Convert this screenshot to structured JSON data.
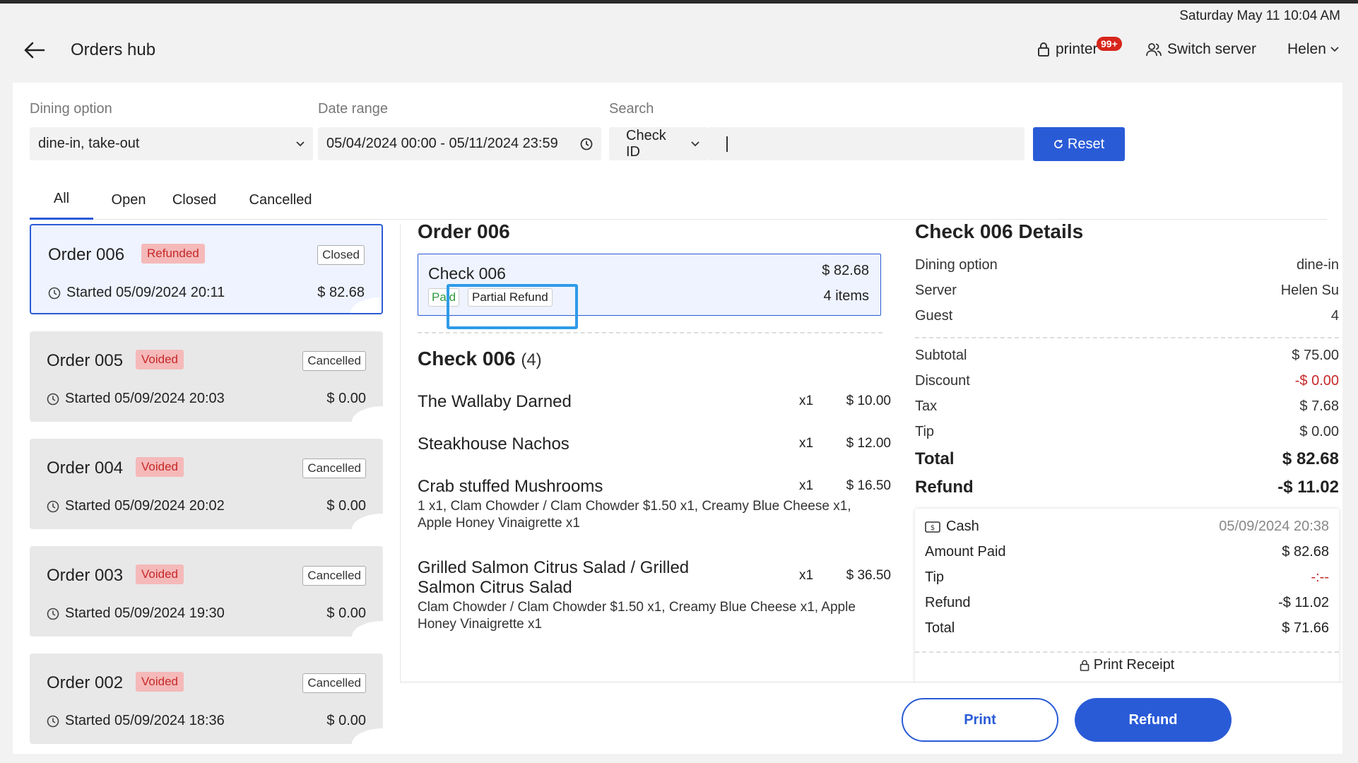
{
  "clock": "Saturday May 11 10:04 AM",
  "header": {
    "title": "Orders hub",
    "printer_label": "printer",
    "printer_badge": "99+",
    "switch_server_label": "Switch server",
    "user_name": "Helen"
  },
  "filters": {
    "dining_label": "Dining option",
    "dining_value": "dine-in, take-out",
    "date_label": "Date range",
    "date_value": "05/04/2024 00:00 - 05/11/2024 23:59",
    "search_label": "Search",
    "search_type": "Check ID",
    "search_value": "",
    "reset_label": "Reset"
  },
  "tabs": [
    "All",
    "Open",
    "Closed",
    "Cancelled"
  ],
  "orders": [
    {
      "name": "Order 006",
      "status": "Refunded",
      "state": "Closed",
      "started": "Started 05/09/2024 20:11",
      "total": "$ 82.68"
    },
    {
      "name": "Order 005",
      "status": "Voided",
      "state": "Cancelled",
      "started": "Started 05/09/2024 20:03",
      "total": "$ 0.00"
    },
    {
      "name": "Order 004",
      "status": "Voided",
      "state": "Cancelled",
      "started": "Started 05/09/2024 20:02",
      "total": "$ 0.00"
    },
    {
      "name": "Order 003",
      "status": "Voided",
      "state": "Cancelled",
      "started": "Started 05/09/2024 19:30",
      "total": "$ 0.00"
    },
    {
      "name": "Order 002",
      "status": "Voided",
      "state": "Cancelled",
      "started": "Started 05/09/2024 18:36",
      "total": "$ 0.00"
    }
  ],
  "order_detail": {
    "title": "Order 006",
    "check": {
      "name": "Check 006",
      "amount": "$ 82.68",
      "items": "4 items",
      "paid_tag": "Paid",
      "refund_tag": "Partial Refund"
    },
    "check_header": "Check 006",
    "check_count": "(4)",
    "items": [
      {
        "name": "The Wallaby Darned",
        "qty": "x1",
        "price": "$ 10.00",
        "mods": ""
      },
      {
        "name": "Steakhouse Nachos",
        "qty": "x1",
        "price": "$ 12.00",
        "mods": ""
      },
      {
        "name": "Crab stuffed Mushrooms",
        "qty": "x1",
        "price": "$ 16.50",
        "mods": "1 x1, Clam Chowder / Clam Chowder $1.50 x1, Creamy Blue Cheese x1, Apple Honey Vinaigrette x1"
      },
      {
        "name": "Grilled Salmon Citrus Salad / Grilled Salmon Citrus Salad",
        "qty": "x1",
        "price": "$ 36.50",
        "mods": "Clam Chowder / Clam Chowder $1.50 x1, Creamy Blue Cheese x1, Apple Honey Vinaigrette x1"
      }
    ]
  },
  "details": {
    "title": "Check 006 Details",
    "dining_label": "Dining option",
    "dining_value": "dine-in",
    "server_label": "Server",
    "server_value": "Helen Su",
    "guest_label": "Guest",
    "guest_value": "4",
    "subtotal_label": "Subtotal",
    "subtotal_value": "$ 75.00",
    "discount_label": "Discount",
    "discount_value": "-$ 0.00",
    "tax_label": "Tax",
    "tax_value": "$ 7.68",
    "tip_label": "Tip",
    "tip_value": "$ 0.00",
    "total_label": "Total",
    "total_value": "$ 82.68",
    "refund_label": "Refund",
    "refund_value": "-$ 11.02",
    "payment": {
      "method": "Cash",
      "date": "05/09/2024 20:38",
      "amount_paid_label": "Amount Paid",
      "amount_paid_value": "$ 82.68",
      "tip_label": "Tip",
      "tip_value": "-:--",
      "refund_label": "Refund",
      "refund_value": "-$ 11.02",
      "total_label": "Total",
      "total_value": "$ 71.66",
      "print_receipt_label": "Print Receipt"
    }
  },
  "footer": {
    "print_label": "Print",
    "refund_label": "Refund"
  },
  "colors": {
    "accent": "#2a5bd7",
    "danger": "#c62828",
    "success": "#2e9b3d",
    "highlight": "#2f9be8"
  }
}
